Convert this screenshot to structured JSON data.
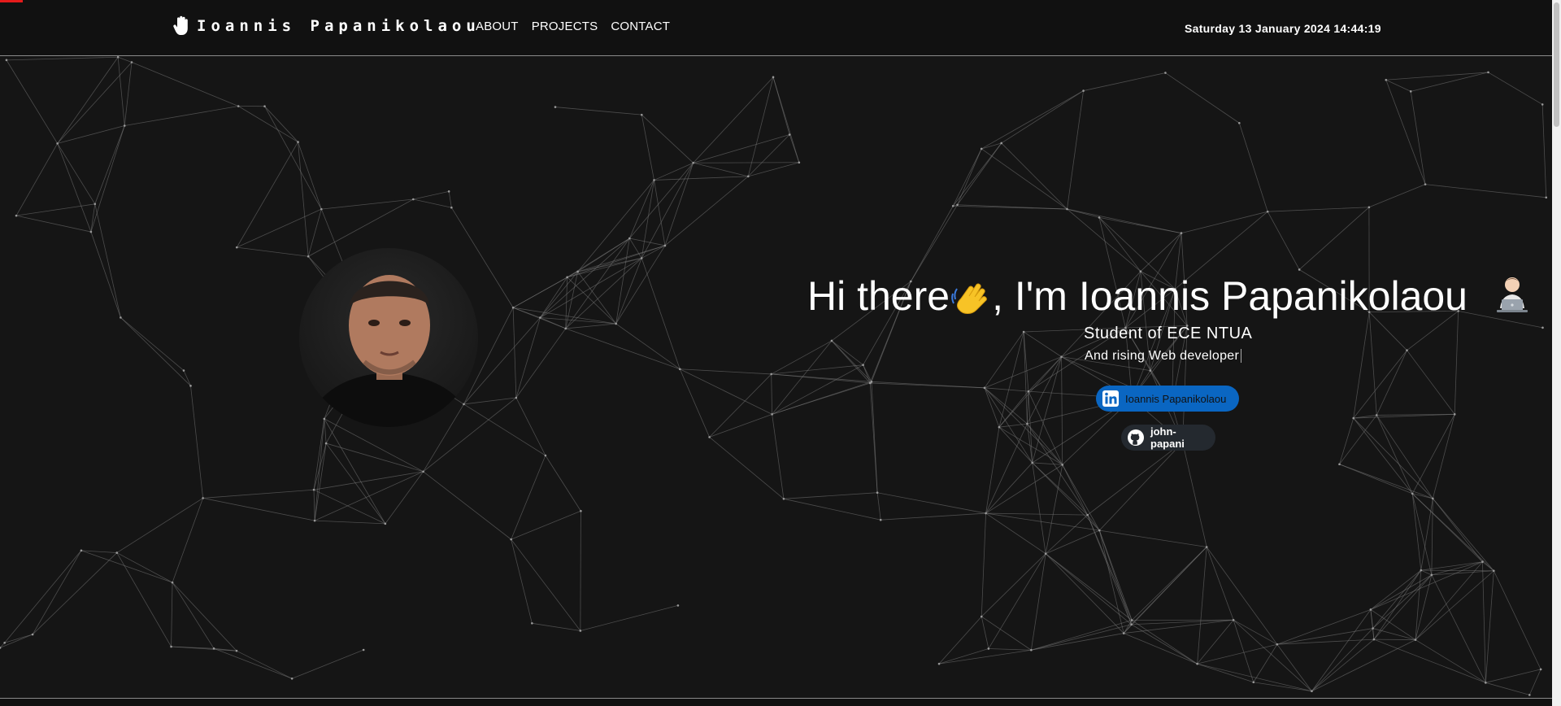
{
  "header": {
    "brand_icon": "raised-hand-icon",
    "brand_name": "Ioannis Papanikolaou",
    "nav": [
      {
        "label": "ABOUT"
      },
      {
        "label": "PROJECTS"
      },
      {
        "label": "CONTACT"
      }
    ],
    "datetime": "Saturday 13 January 2024 14:44:19"
  },
  "hero": {
    "headline_before": "Hi there",
    "headline_wave_icon": "waving-hand-emoji",
    "headline_after": ", I'm Ioannis Papanikolaou",
    "headline_end_icon": "technologist-emoji",
    "subtitle": "Student of ECE NTUA",
    "tagline": "And rising Web developer",
    "profile_photo": "portrait-photo",
    "background": "particle-network"
  },
  "social": {
    "linkedin": {
      "icon": "linkedin-icon",
      "label": "Ioannis Papanikolaou",
      "color": "#0a66c2"
    },
    "github": {
      "icon": "github-icon",
      "label": "john-papani",
      "color": "#24292f"
    }
  },
  "colors": {
    "background": "#151515",
    "navbar": "#111111",
    "accent_red": "#e41b1b"
  }
}
